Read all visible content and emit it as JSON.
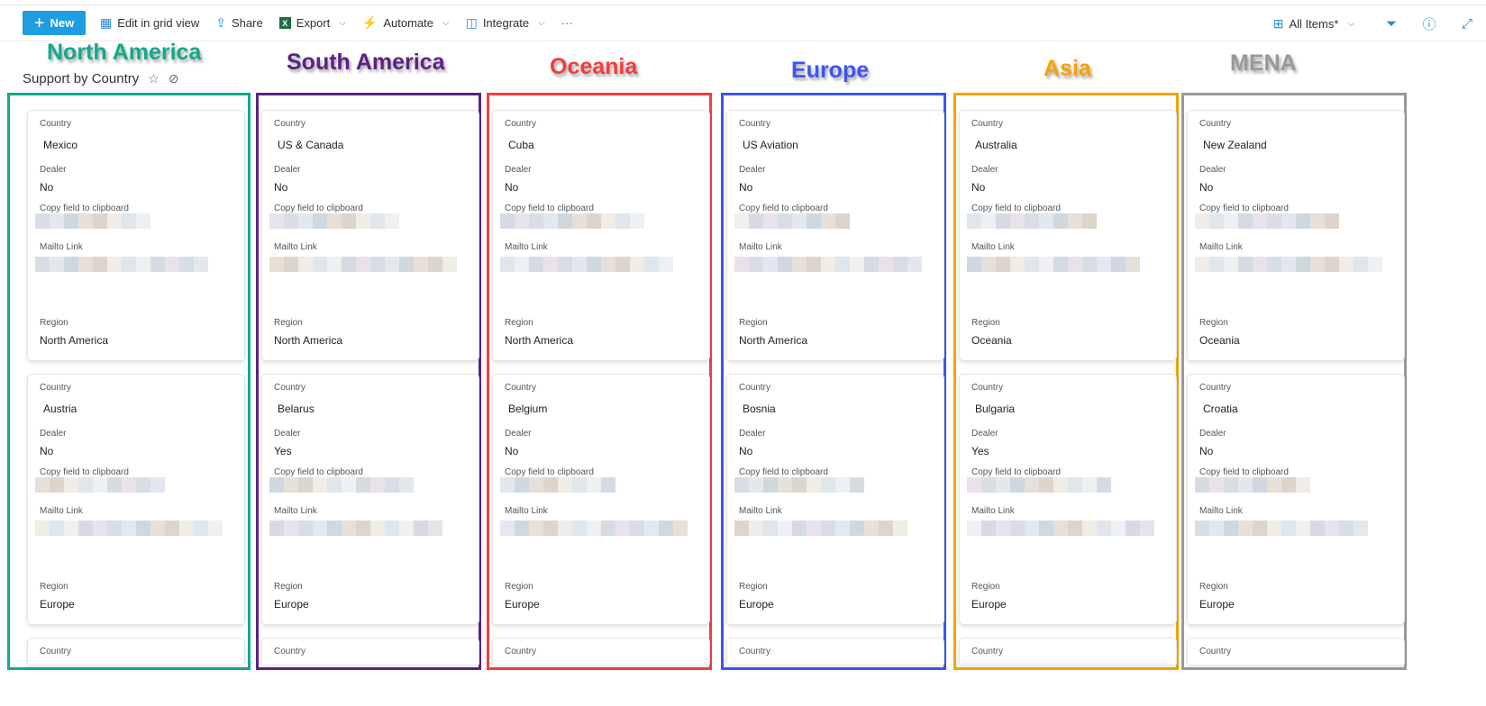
{
  "toolbar": {
    "new": "New",
    "edit_grid": "Edit in grid view",
    "share": "Share",
    "export": "Export",
    "automate": "Automate",
    "integrate": "Integrate",
    "more": "···",
    "view": "All Items*"
  },
  "page_title": "Support by Country",
  "labels": {
    "country": "Country",
    "dealer": "Dealer",
    "copy": "Copy field to clipboard",
    "mailto": "Mailto Link",
    "region": "Region"
  },
  "columns": [
    {
      "annotation": "North America",
      "color": "#14a88a",
      "cards": [
        {
          "country": "Mexico",
          "dealer": "No",
          "region": "North America"
        },
        {
          "country": "Austria",
          "dealer": "No",
          "region": "Europe"
        }
      ]
    },
    {
      "annotation": "South America",
      "color": "#5c2185",
      "cards": [
        {
          "country": "US & Canada",
          "dealer": "No",
          "region": "North America"
        },
        {
          "country": "Belarus",
          "dealer": "Yes",
          "region": "Europe"
        }
      ]
    },
    {
      "annotation": "Oceania",
      "color": "#f53d3d",
      "cards": [
        {
          "country": "Cuba",
          "dealer": "No",
          "region": "North America"
        },
        {
          "country": "Belgium",
          "dealer": "No",
          "region": "Europe"
        }
      ]
    },
    {
      "annotation": "Europe",
      "color": "#3b55f5",
      "cards": [
        {
          "country": "US Aviation",
          "dealer": "No",
          "region": "North America"
        },
        {
          "country": "Bosnia",
          "dealer": "No",
          "region": "Europe"
        }
      ]
    },
    {
      "annotation": "Asia",
      "color": "#f5a300",
      "cards": [
        {
          "country": "Australia",
          "dealer": "No",
          "region": "Oceania"
        },
        {
          "country": "Bulgaria",
          "dealer": "Yes",
          "region": "Europe"
        }
      ]
    },
    {
      "annotation": "MENA",
      "color": "#999999",
      "cards": [
        {
          "country": "New Zealand",
          "dealer": "No",
          "region": "Oceania"
        },
        {
          "country": "Croatia",
          "dealer": "No",
          "region": "Europe"
        }
      ]
    }
  ]
}
